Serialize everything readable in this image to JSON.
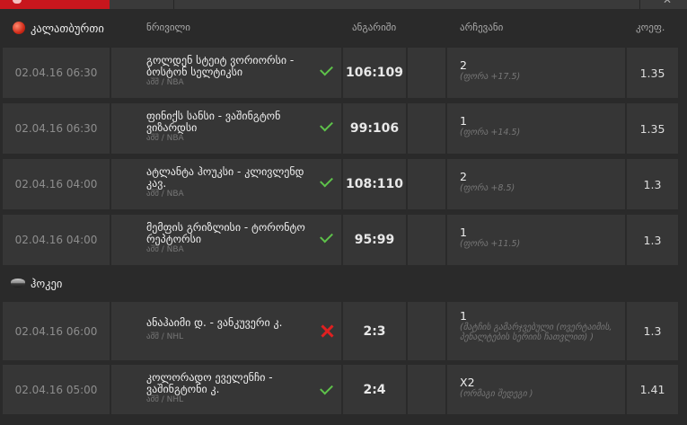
{
  "columns": {
    "event": "ნრივილი",
    "score": "ანგარიში",
    "pick": "არჩევანი",
    "odds": "კოეფ."
  },
  "sports": [
    {
      "name": "კალათბურთი",
      "icon": "basketball-icon",
      "matches": [
        {
          "date": "02.04.16 06:30",
          "teams": "გოლდენ სტეიტ ვორიორსი - ბოსტონ სელტიკსი",
          "league": "აშშ / NBA",
          "status": "won",
          "score": "106:109",
          "pick": "2",
          "pick_note": "(ფორა +17.5)",
          "odds": "1.35"
        },
        {
          "date": "02.04.16 06:30",
          "teams": "ფინიქს სანსი - ვაშინგტონ ვიზარდსი",
          "league": "აშშ / NBA",
          "status": "won",
          "score": "99:106",
          "pick": "1",
          "pick_note": "(ფორა +14.5)",
          "odds": "1.35"
        },
        {
          "date": "02.04.16 04:00",
          "teams": "ატლანტა ჰოუკსი - კლივლენდ კავ.",
          "league": "აშშ / NBA",
          "status": "won",
          "score": "108:110",
          "pick": "2",
          "pick_note": "(ფორა +8.5)",
          "odds": "1.3"
        },
        {
          "date": "02.04.16 04:00",
          "teams": "მემფის გრიზლისი - ტორონტო რეპტორსი",
          "league": "აშშ / NBA",
          "status": "won",
          "score": "95:99",
          "pick": "1",
          "pick_note": "(ფორა +11.5)",
          "odds": "1.3"
        }
      ]
    },
    {
      "name": "ჰოკეი",
      "icon": "hockey-puck-icon",
      "matches": [
        {
          "date": "02.04.16 06:00",
          "teams": "ანაჰაიმი დ. - ვანკუვერი კ.",
          "league": "აშშ / NHL",
          "status": "lost",
          "score": "2:3",
          "pick": "1",
          "pick_note": "(მატჩის გამარჯვებული (ოვერტაიმის, პენალტების სერიის ჩათვლით) )",
          "odds": "1.3"
        },
        {
          "date": "02.04.16 05:00",
          "teams": "კოლორადო ეველენჩი - ვაშინგტონი კ.",
          "league": "აშშ / NHL",
          "status": "won",
          "score": "2:4",
          "pick": "X2",
          "pick_note": "(ორმაგი შედეგი )",
          "odds": "1.41"
        }
      ]
    }
  ],
  "colors": {
    "accent": "#c8161d",
    "won": "#5ec24a",
    "lost": "#e02020",
    "background": "#2a2a2a",
    "cell": "#363636"
  }
}
